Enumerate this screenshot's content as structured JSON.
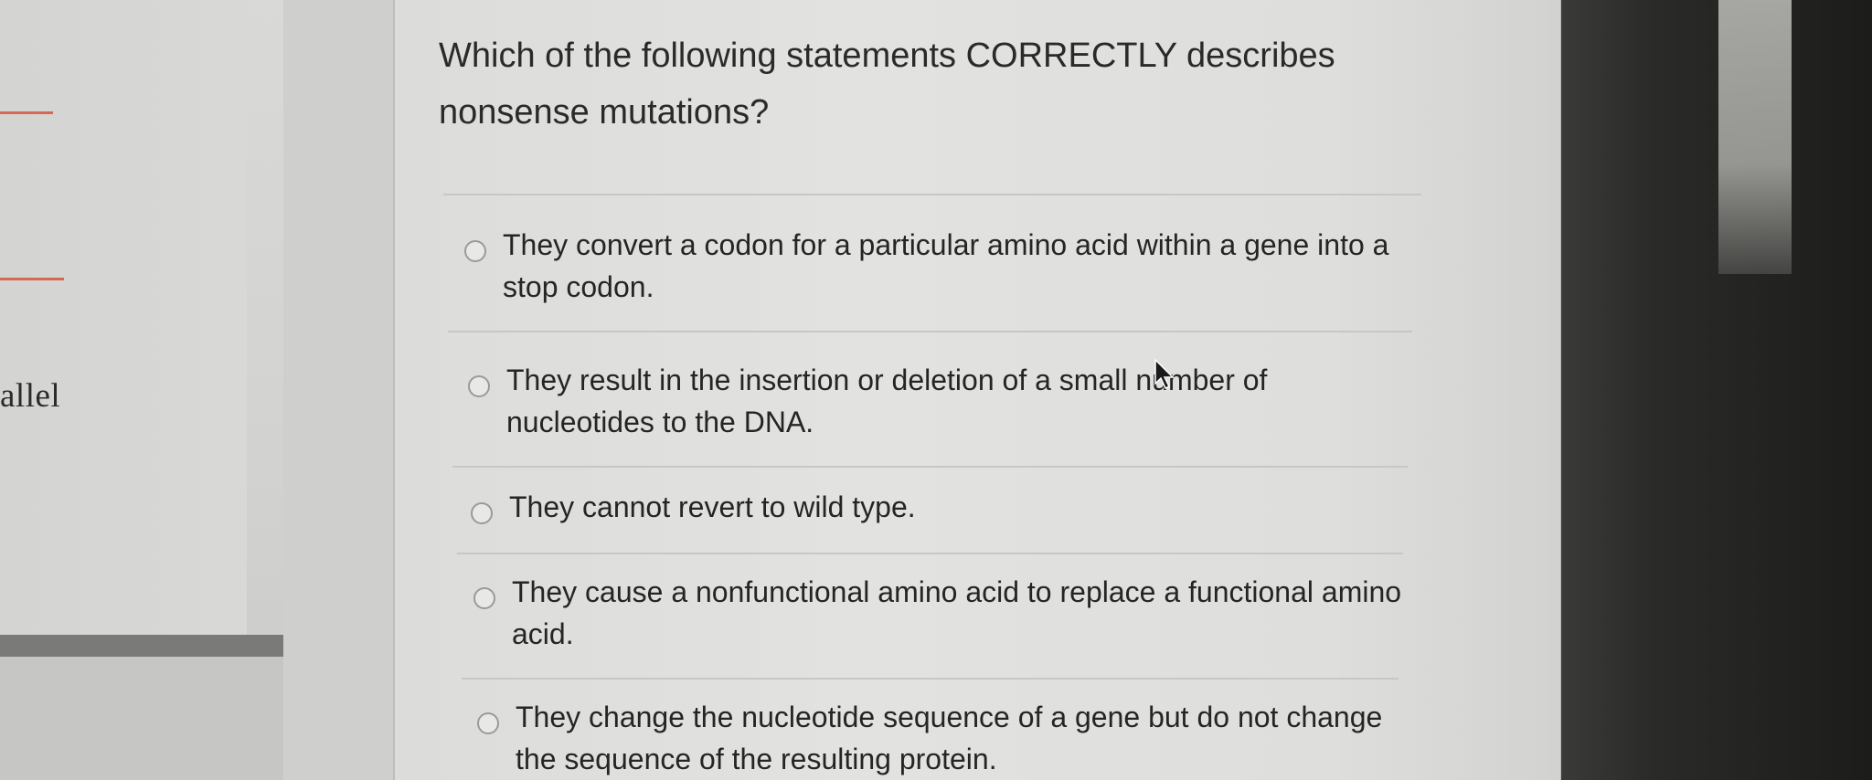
{
  "sidebar": {
    "partial_word": "allel"
  },
  "question": {
    "text": "Which of the following statements CORRECTLY describes nonsense mutations?"
  },
  "options": [
    {
      "label": "They convert a codon for a particular amino acid within a gene into a stop codon."
    },
    {
      "label": "They result in the insertion or deletion of a small number of nucleotides to the DNA."
    },
    {
      "label": "They cannot revert to wild type."
    },
    {
      "label": "They cause a nonfunctional amino acid to replace a functional amino acid."
    },
    {
      "label": "They change the nucleotide sequence of a gene but do not change the sequence of the resulting protein."
    }
  ],
  "colors": {
    "accent": "#d46a55",
    "text": "#2a2a2a",
    "card_background": "#e0e0de"
  },
  "icons": {
    "cursor": "mouse-pointer-icon",
    "radio": "radio-button-icon"
  }
}
